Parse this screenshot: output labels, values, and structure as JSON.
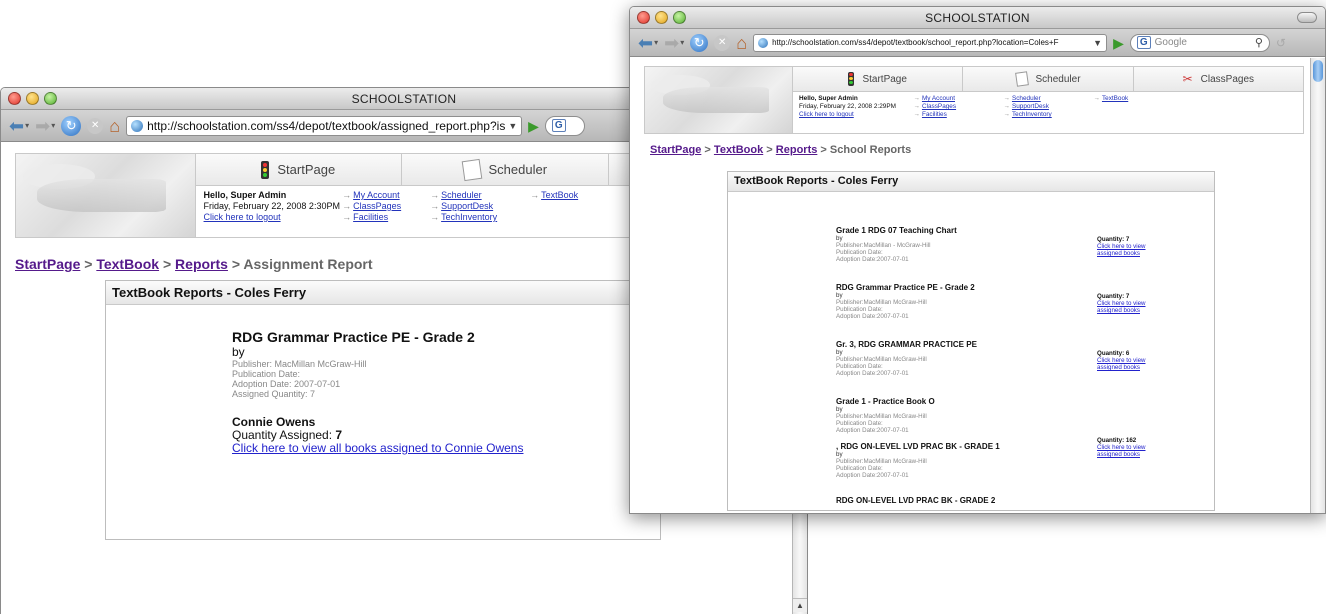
{
  "back_window": {
    "title": "SCHOOLSTATION",
    "url": "http://schoolstation.com/ss4/depot/textbook/assigned_report.php?is",
    "tabs": [
      {
        "label": "StartPage",
        "icon": "traffic-light-icon"
      },
      {
        "label": "Scheduler",
        "icon": "notepad-icon"
      }
    ],
    "greeting": "Hello, Super Admin",
    "date": "Friday, February 22, 2008 2:30PM",
    "logout": "Click here to logout",
    "links_col1": [
      "My Account",
      "ClassPages",
      "Facilities"
    ],
    "links_col2": [
      "Scheduler",
      "SupportDesk",
      "TechInventory"
    ],
    "links_col3": [
      "TextBook"
    ],
    "breadcrumb": {
      "startpage": "StartPage",
      "textbook": "TextBook",
      "reports": "Reports",
      "current": "Assignment Report",
      "sep": ">"
    },
    "panel_title": "TextBook Reports - Coles Ferry",
    "book": {
      "title": "RDG Grammar Practice PE - Grade 2",
      "by": "by",
      "publisher": "Publisher: MacMillan McGraw-Hill",
      "pub_date": "Publication Date:",
      "adoption": "Adoption Date: 2007-07-01",
      "assigned": "Assigned Quantity: 7"
    },
    "person": {
      "name": "Connie Owens",
      "qty_label": "Quantity Assigned:",
      "qty_value": "7",
      "link": "Click here to view all books assigned to Connie Owens"
    }
  },
  "front_window": {
    "title": "SCHOOLSTATION",
    "url": "http://schoolstation.com/ss4/depot/textbook/school_report.php?location=Coles+F",
    "search_placeholder": "Google",
    "tabs": [
      {
        "label": "StartPage",
        "icon": "traffic-light-icon"
      },
      {
        "label": "Scheduler",
        "icon": "notepad-icon"
      },
      {
        "label": "ClassPages",
        "icon": "scissors-icon"
      }
    ],
    "greeting": "Hello, Super Admin",
    "date": "Friday, February 22, 2008 2:29PM",
    "logout": "Click here to logout",
    "links_col1": [
      "My Account",
      "ClassPages",
      "Facilities"
    ],
    "links_col2": [
      "Scheduler",
      "SupportDesk",
      "TechInventory"
    ],
    "links_col3": [
      "TextBook"
    ],
    "breadcrumb": {
      "startpage": "StartPage",
      "textbook": "TextBook",
      "reports": "Reports",
      "current": "School Reports",
      "sep": ">"
    },
    "panel_title": "TextBook Reports - Coles Ferry",
    "books": [
      {
        "title": "Grade 1 RDG 07 Teaching Chart",
        "by": "by",
        "publisher": "Publisher:MacMillan - McGraw-Hill",
        "pub_date": "Publication Date:",
        "adoption": "Adoption Date:2007-07-01"
      },
      {
        "title": "RDG Grammar Practice PE - Grade 2",
        "by": "by",
        "publisher": "Publisher:MacMillan McGraw-Hill",
        "pub_date": "Publication Date:",
        "adoption": "Adoption Date:2007-07-01"
      },
      {
        "title": "Gr. 3, RDG GRAMMAR PRACTICE PE",
        "by": "by",
        "publisher": "Publisher:MacMillan McGraw-Hill",
        "pub_date": "Publication Date:",
        "adoption": "Adoption Date:2007-07-01"
      },
      {
        "title": "Grade 1 - Practice Book O",
        "by": "by",
        "publisher": "Publisher:MacMillan McGraw-Hill",
        "pub_date": "Publication Date:",
        "adoption": "Adoption Date:2007-07-01"
      },
      {
        "title": ", RDG ON-LEVEL LVD PRAC BK - GRADE 1",
        "by": "by",
        "publisher": "Publisher:MacMillan McGraw-Hill",
        "pub_date": "Publication Date:",
        "adoption": "Adoption Date:2007-07-01"
      },
      {
        "title": "RDG ON-LEVEL LVD PRAC BK - GRADE 2",
        "by": "",
        "publisher": "",
        "pub_date": "",
        "adoption": ""
      }
    ],
    "quantities": [
      {
        "label": "Quantity: 7",
        "link": "Click here to view assigned books"
      },
      {
        "label": "Quantity: 7",
        "link": "Click here to view assigned books"
      },
      {
        "label": "Quantity: 6",
        "link": "Click here to view assigned books"
      },
      {
        "label": "Quantity: 162",
        "link": "Click here to view assigned books"
      }
    ]
  },
  "colors": {
    "link": "#2222cc",
    "visited": "#551a8b",
    "accent_blue": "#4a7fb4"
  }
}
